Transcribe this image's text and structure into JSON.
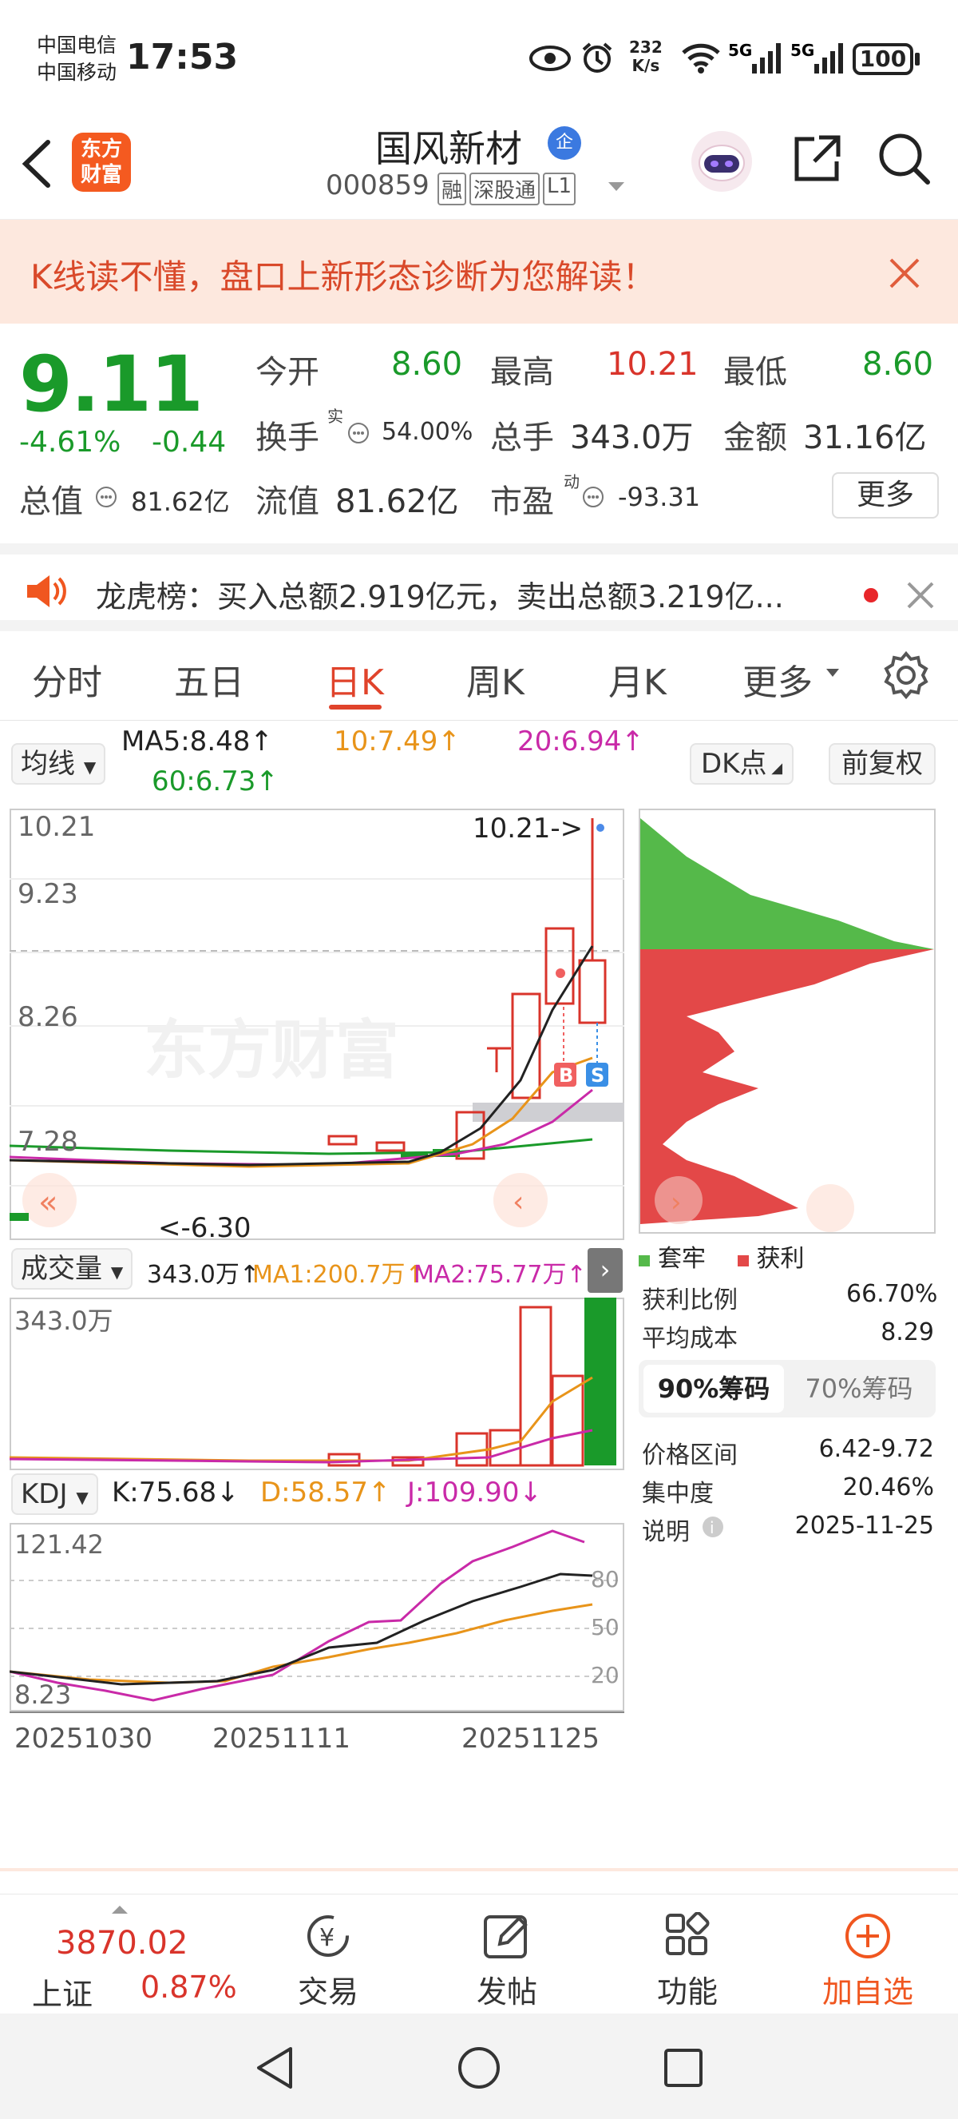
{
  "status": {
    "carrier1": "中国电信",
    "carrier2": "中国移动",
    "time": "17:53",
    "speed_value": "232",
    "speed_unit": "K/s",
    "battery": "100"
  },
  "nav": {
    "title": "国风新材",
    "title_badge": "企",
    "code": "000859",
    "tags": [
      "融",
      "深股通",
      "L1"
    ],
    "logo_line1": "东方",
    "logo_line2": "财富"
  },
  "banner": {
    "text": "K线读不懂，盘口上新形态诊断为您解读！"
  },
  "quote": {
    "price": "9.11",
    "change_pct": "-4.61%",
    "change": "-0.44",
    "open_label": "今开",
    "open": "8.60",
    "high_label": "最高",
    "high": "10.21",
    "low_label": "最低",
    "low": "8.60",
    "turnover_label": "换手",
    "turnover_sup": "实",
    "turnover": "54.00%",
    "volume_label": "总手",
    "volume": "343.0万",
    "amount_label": "金额",
    "amount": "31.16亿",
    "mktcap_label": "总值",
    "mktcap": "81.62亿",
    "float_label": "流值",
    "float": "81.62亿",
    "pe_label": "市盈",
    "pe_sup": "动",
    "pe": "-93.31",
    "more": "更多"
  },
  "notice": {
    "text": "龙虎榜：买入总额2.919亿元，卖出总额3.219亿..."
  },
  "tabs": [
    {
      "label": "分时"
    },
    {
      "label": "五日"
    },
    {
      "label": "日K"
    },
    {
      "label": "周K"
    },
    {
      "label": "月K"
    },
    {
      "label": "更多"
    }
  ],
  "kline": {
    "ma_selector": "均线",
    "ma5": "MA5:8.48↑",
    "ma10": "10:7.49↑",
    "ma20": "20:6.94↑",
    "ma60": "60:6.73↑",
    "dk_button": "DK点",
    "adjust_button": "前复权",
    "y_labels": [
      "10.21",
      "9.23",
      "8.26",
      "7.28"
    ],
    "max_label": "10.21->",
    "min_label": "<-6.30",
    "low_left": "6.30",
    "watermark": "东方财富",
    "buy_marker": "B",
    "sell_marker": "S"
  },
  "volume_panel": {
    "selector": "成交量",
    "total": "343.0万↑",
    "ma1": "MA1:200.7万↑",
    "ma2": "MA2:75.77万↑",
    "y_label": "343.0万"
  },
  "kdj_panel": {
    "selector": "KDJ",
    "k": "K:75.68↓",
    "d": "D:58.57↑",
    "j": "J:109.90↓",
    "y_top": "121.42",
    "y_bottom": "8.23",
    "levels": [
      "80",
      "50",
      "20"
    ]
  },
  "dates": [
    "20251030",
    "20251111",
    "20251125"
  ],
  "chips": {
    "legend_trapped": "套牢",
    "legend_profit": "获利",
    "rows": [
      {
        "label": "获利比例",
        "value": "66.70%"
      },
      {
        "label": "平均成本",
        "value": "8.29"
      }
    ],
    "tab90": "90%筹码",
    "tab70": "70%筹码",
    "rows2": [
      {
        "label": "价格区间",
        "value": "6.42-9.72"
      },
      {
        "label": "集中度",
        "value": "20.46%"
      },
      {
        "label": "说明",
        "value": "2025-11-25"
      }
    ]
  },
  "bottom_nav": {
    "index_value": "3870.02",
    "index_name": "上证",
    "index_change": "0.87%",
    "trade": "交易",
    "post": "发帖",
    "func": "功能",
    "add": "加自选"
  }
}
